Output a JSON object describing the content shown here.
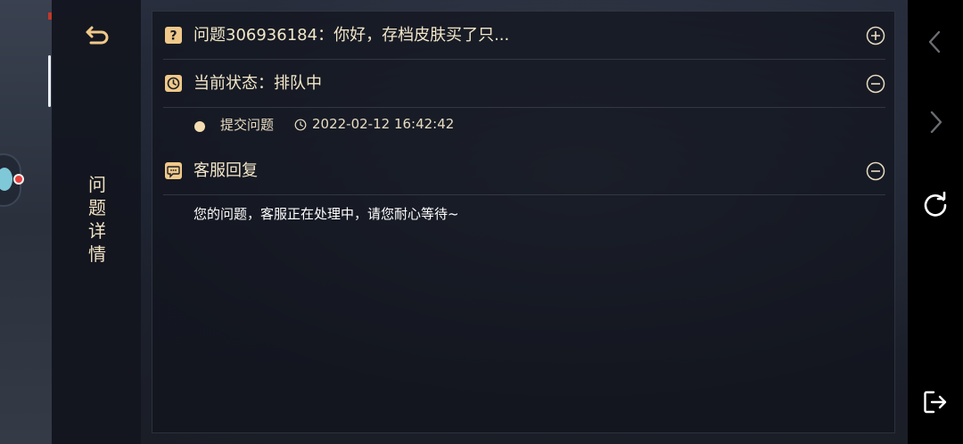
{
  "side_panel": {
    "back_icon": "back-arrow-icon",
    "title_chars": [
      "问",
      "题",
      "详",
      "情"
    ]
  },
  "question": {
    "icon": "question-mark-icon",
    "label": "问题306936184：你好，存档皮肤买了只...",
    "toggle_icon": "plus-circle-icon"
  },
  "status": {
    "icon": "clock-icon",
    "label": "当前状态：排队中",
    "toggle_icon": "minus-circle-icon",
    "steps": [
      {
        "label": "提交问题",
        "time": "2022-02-12 16:42:42"
      }
    ]
  },
  "reply": {
    "icon": "chat-bubble-icon",
    "label": "客服回复",
    "toggle_icon": "minus-circle-icon",
    "text": "您的问题，客服正在处理中，请您耐心等待~"
  },
  "nav": {
    "items": [
      "chevron-left-icon",
      "chevron-right-icon",
      "refresh-icon",
      "exit-icon"
    ]
  },
  "colors": {
    "accent": "#f0c98a",
    "text_primary": "#f3e7c9",
    "panel_bg": "#12161e"
  }
}
